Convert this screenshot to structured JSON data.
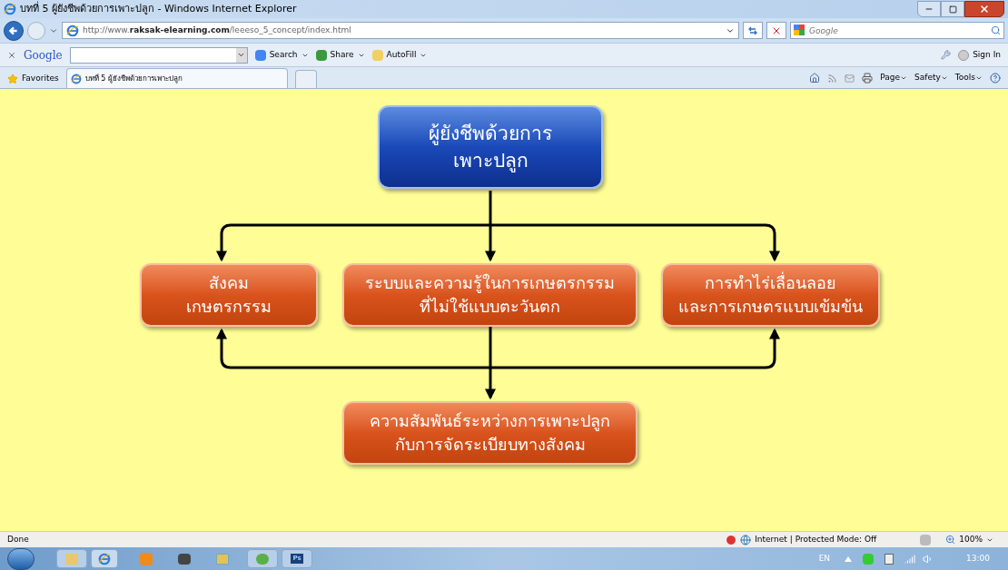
{
  "window": {
    "title": "บทที่ 5 ผู้ยังชีพด้วยการเพาะปลูก - Windows Internet Explorer"
  },
  "address_bar": {
    "url_plain": "http://www.",
    "url_domain": "raksak-elearning.com",
    "url_path": "/leeeso_5_concept/index.html",
    "search_placeholder": "Google"
  },
  "google_toolbar": {
    "logo": "Google",
    "buttons": [
      "Search",
      "Share",
      "AutoFill"
    ],
    "sign_in": "Sign In"
  },
  "favorites_bar": {
    "favorites": "Favorites",
    "tabs": [
      {
        "title": "บทที่ 5 ผู้ยังชีพด้วยการเพาะปลูก",
        "selected": true
      }
    ]
  },
  "command_bar": [
    "Page",
    "Safety",
    "Tools"
  ],
  "diagram": {
    "root": "ผู้ยังชีพด้วยการ\nเพาะปลูก",
    "branches": [
      "สังคม\nเกษตรกรรม",
      "ระบบและความรู้ในการเกษตรกรรม\nที่ไม่ใช้แบบตะวันตก",
      "การทำไร่เลื่อนลอย\nและการเกษตรแบบเข้มข้น"
    ],
    "result": "ความสัมพันธ์ระหว่างการเพาะปลูก\nกับการจัดระเบียบทางสังคม"
  },
  "status_bar": {
    "status": "Done",
    "zone": "Internet | Protected Mode: Off",
    "zoom": "100%"
  },
  "taskbar": {
    "ps_label": "Ps",
    "language": "EN",
    "time": "13:00"
  }
}
